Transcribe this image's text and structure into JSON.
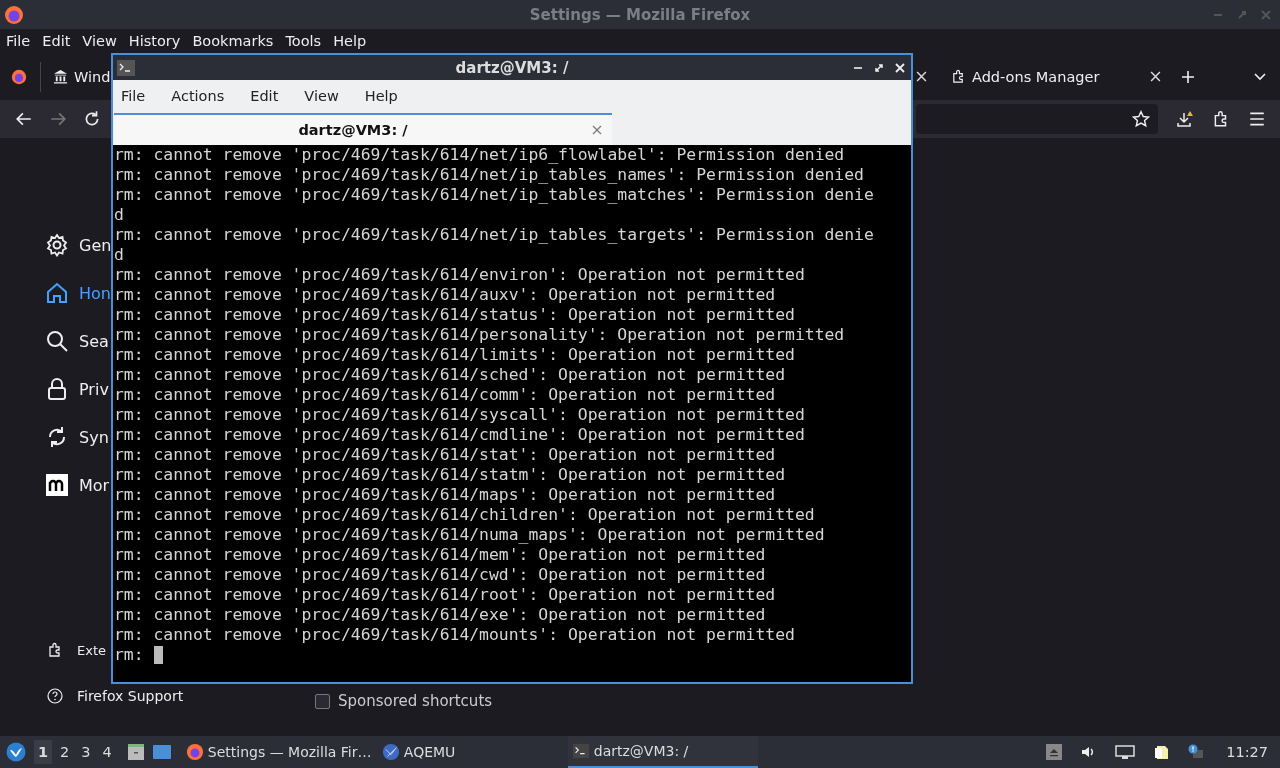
{
  "firefox": {
    "title": "Settings — Mozilla Firefox",
    "menu": [
      "File",
      "Edit",
      "View",
      "History",
      "Bookmarks",
      "Tools",
      "Help"
    ],
    "tabs": [
      {
        "label": "Wind"
      },
      {
        "label": "Add-ons Manager"
      }
    ],
    "sidebar": {
      "items": [
        {
          "label": "Gen",
          "selected": false
        },
        {
          "label": "Hon",
          "selected": true
        },
        {
          "label": "Sea",
          "selected": false
        },
        {
          "label": "Priv",
          "selected": false
        },
        {
          "label": "Syn",
          "selected": false
        },
        {
          "label": "Mor",
          "selected": false
        }
      ],
      "footer": [
        "Exte",
        "Firefox Support"
      ]
    },
    "sponsored": {
      "label": "Sponsored shortcuts",
      "checked": false
    }
  },
  "terminal": {
    "title": "dartz@VM3: /",
    "menu": [
      "File",
      "Actions",
      "Edit",
      "View",
      "Help"
    ],
    "tab": "dartz@VM3: /",
    "lines": [
      "rm: cannot remove 'proc/469/task/614/net/ip6_flowlabel': Permission denied",
      "rm: cannot remove 'proc/469/task/614/net/ip_tables_names': Permission denied",
      "rm: cannot remove 'proc/469/task/614/net/ip_tables_matches': Permission denie",
      "d",
      "rm: cannot remove 'proc/469/task/614/net/ip_tables_targets': Permission denie",
      "d",
      "rm: cannot remove 'proc/469/task/614/environ': Operation not permitted",
      "rm: cannot remove 'proc/469/task/614/auxv': Operation not permitted",
      "rm: cannot remove 'proc/469/task/614/status': Operation not permitted",
      "rm: cannot remove 'proc/469/task/614/personality': Operation not permitted",
      "rm: cannot remove 'proc/469/task/614/limits': Operation not permitted",
      "rm: cannot remove 'proc/469/task/614/sched': Operation not permitted",
      "rm: cannot remove 'proc/469/task/614/comm': Operation not permitted",
      "rm: cannot remove 'proc/469/task/614/syscall': Operation not permitted",
      "rm: cannot remove 'proc/469/task/614/cmdline': Operation not permitted",
      "rm: cannot remove 'proc/469/task/614/stat': Operation not permitted",
      "rm: cannot remove 'proc/469/task/614/statm': Operation not permitted",
      "rm: cannot remove 'proc/469/task/614/maps': Operation not permitted",
      "rm: cannot remove 'proc/469/task/614/children': Operation not permitted",
      "rm: cannot remove 'proc/469/task/614/numa_maps': Operation not permitted",
      "rm: cannot remove 'proc/469/task/614/mem': Operation not permitted",
      "rm: cannot remove 'proc/469/task/614/cwd': Operation not permitted",
      "rm: cannot remove 'proc/469/task/614/root': Operation not permitted",
      "rm: cannot remove 'proc/469/task/614/exe': Operation not permitted",
      "rm: cannot remove 'proc/469/task/614/mounts': Operation not permitted"
    ],
    "prompt": "rm:"
  },
  "taskbar": {
    "workspaces": [
      {
        "label": "1",
        "selected": true
      },
      {
        "label": "2",
        "selected": false
      },
      {
        "label": "3",
        "selected": false
      },
      {
        "label": "4",
        "selected": false
      }
    ],
    "tasks": [
      {
        "label": "Settings — Mozilla Fir…",
        "selected": false
      },
      {
        "label": "AQEMU",
        "selected": false
      },
      {
        "label": "dartz@VM3: /",
        "selected": true
      }
    ],
    "clock": "11:27"
  }
}
